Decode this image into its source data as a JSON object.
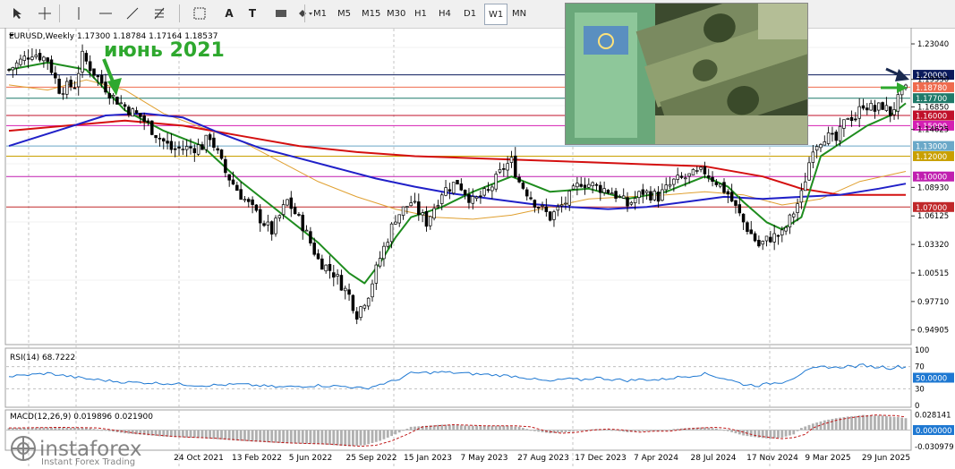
{
  "toolbar": {
    "tools": [
      {
        "name": "cursor-tool-icon"
      },
      {
        "name": "crosshair-tool-icon"
      },
      {
        "name": "vertical-line-tool-icon"
      },
      {
        "name": "horizontal-line-tool-icon"
      },
      {
        "name": "trendline-tool-icon"
      },
      {
        "name": "fibonacci-tool-icon"
      },
      {
        "name": "channel-tool-icon"
      },
      {
        "name": "text-tool-icon",
        "glyph": "A"
      },
      {
        "name": "text-label-tool-icon",
        "glyph": "T"
      },
      {
        "name": "rectangle-tool-icon"
      },
      {
        "name": "shapes-tool-icon"
      }
    ],
    "timeframes": [
      "M1",
      "M5",
      "M15",
      "M30",
      "H1",
      "H4",
      "D1",
      "W1",
      "MN"
    ],
    "active_timeframe": "W1"
  },
  "chart_data": {
    "type": "candlestick",
    "symbol_line": "EURUSD,Weekly  1.17300 1.18784 1.17164 1.18537",
    "annotation": "июнь 2021",
    "watermark": {
      "brand": "instaforex",
      "tagline": "Instant Forex Trading"
    },
    "price_axis": {
      "ylim": [
        0.9365,
        1.2445
      ],
      "ticks": [
        "1.23040",
        "1.20000",
        "1.19550",
        "1.18780",
        "1.17700",
        "1.16850",
        "1.16000",
        "1.15000",
        "1.14625",
        "1.13000",
        "1.12000",
        "1.10000",
        "1.08930",
        "1.07000",
        "1.06125",
        "1.03320",
        "1.00515",
        "0.97710",
        "0.94905"
      ]
    },
    "highlighted_levels": [
      {
        "label": "1.20000",
        "color": "#0a1a5c"
      },
      {
        "label": "1.18780",
        "color": "#ef6b4e"
      },
      {
        "label": "1.17700",
        "color": "#1f7a6a"
      },
      {
        "label": "1.16000",
        "color": "#c0102a"
      },
      {
        "label": "1.15000",
        "color": "#d41fb3"
      },
      {
        "label": "1.13000",
        "color": "#6aa8c8"
      },
      {
        "label": "1.12000",
        "color": "#c9a000"
      },
      {
        "label": "1.10000",
        "color": "#c01fb0"
      },
      {
        "label": "1.07000",
        "color": "#c0282a"
      }
    ],
    "x_labels": [
      "24 Oct 2021",
      "13 Feb 2022",
      "5 Jun 2022",
      "25 Sep 2022",
      "15 Jan 2023",
      "7 May 2023",
      "27 Aug 2023",
      "17 Dec 2023",
      "7 Apr 2024",
      "28 Jul 2024",
      "17 Nov 2024",
      "9 Mar 2025",
      "29 Jun 2025"
    ],
    "close_path": [
      [
        0,
        1.205
      ],
      [
        6,
        1.222
      ],
      [
        10,
        1.215
      ],
      [
        13,
        1.186
      ],
      [
        17,
        1.19
      ],
      [
        19,
        1.218
      ],
      [
        23,
        1.197
      ],
      [
        27,
        1.178
      ],
      [
        32,
        1.163
      ],
      [
        34,
        1.159
      ],
      [
        38,
        1.142
      ],
      [
        42,
        1.127
      ],
      [
        47,
        1.128
      ],
      [
        50,
        1.13
      ],
      [
        52,
        1.14
      ],
      [
        56,
        1.104
      ],
      [
        60,
        1.082
      ],
      [
        64,
        1.063
      ],
      [
        68,
        1.046
      ],
      [
        72,
        1.076
      ],
      [
        76,
        1.052
      ],
      [
        80,
        1.018
      ],
      [
        84,
        1.005
      ],
      [
        88,
        0.983
      ],
      [
        90,
        0.965
      ],
      [
        93,
        0.985
      ],
      [
        96,
        1.02
      ],
      [
        100,
        1.06
      ],
      [
        104,
        1.075
      ],
      [
        108,
        1.055
      ],
      [
        112,
        1.085
      ],
      [
        116,
        1.095
      ],
      [
        120,
        1.075
      ],
      [
        124,
        1.085
      ],
      [
        128,
        1.109
      ],
      [
        130,
        1.115
      ],
      [
        132,
        1.095
      ],
      [
        136,
        1.075
      ],
      [
        140,
        1.06
      ],
      [
        144,
        1.075
      ],
      [
        148,
        1.095
      ],
      [
        152,
        1.09
      ],
      [
        156,
        1.085
      ],
      [
        160,
        1.072
      ],
      [
        164,
        1.085
      ],
      [
        168,
        1.08
      ],
      [
        172,
        1.095
      ],
      [
        176,
        1.1
      ],
      [
        180,
        1.105
      ],
      [
        183,
        1.095
      ],
      [
        186,
        1.083
      ],
      [
        190,
        1.055
      ],
      [
        194,
        1.032
      ],
      [
        197,
        1.04
      ],
      [
        200,
        1.043
      ],
      [
        203,
        1.065
      ],
      [
        205,
        1.082
      ],
      [
        208,
        1.13
      ],
      [
        211,
        1.14
      ],
      [
        214,
        1.135
      ],
      [
        217,
        1.16
      ],
      [
        219,
        1.158
      ],
      [
        221,
        1.172
      ],
      [
        224,
        1.165
      ],
      [
        226,
        1.17
      ],
      [
        228,
        1.162
      ],
      [
        230,
        1.175
      ],
      [
        232,
        1.185
      ]
    ],
    "ma_fast": [
      [
        0,
        1.205
      ],
      [
        10,
        1.212
      ],
      [
        20,
        1.205
      ],
      [
        30,
        1.165
      ],
      [
        40,
        1.145
      ],
      [
        50,
        1.13
      ],
      [
        60,
        1.095
      ],
      [
        70,
        1.065
      ],
      [
        80,
        1.035
      ],
      [
        88,
        1.005
      ],
      [
        92,
        0.995
      ],
      [
        96,
        1.015
      ],
      [
        100,
        1.04
      ],
      [
        104,
        1.06
      ],
      [
        112,
        1.07
      ],
      [
        120,
        1.085
      ],
      [
        130,
        1.1
      ],
      [
        140,
        1.085
      ],
      [
        150,
        1.088
      ],
      [
        160,
        1.078
      ],
      [
        170,
        1.085
      ],
      [
        180,
        1.1
      ],
      [
        186,
        1.09
      ],
      [
        190,
        1.075
      ],
      [
        196,
        1.055
      ],
      [
        200,
        1.048
      ],
      [
        205,
        1.06
      ],
      [
        210,
        1.12
      ],
      [
        216,
        1.135
      ],
      [
        222,
        1.15
      ],
      [
        228,
        1.16
      ],
      [
        232,
        1.172
      ]
    ],
    "ma_slow_orange": [
      [
        0,
        1.19
      ],
      [
        10,
        1.185
      ],
      [
        20,
        1.195
      ],
      [
        30,
        1.185
      ],
      [
        40,
        1.162
      ],
      [
        50,
        1.148
      ],
      [
        60,
        1.135
      ],
      [
        70,
        1.115
      ],
      [
        80,
        1.095
      ],
      [
        90,
        1.08
      ],
      [
        100,
        1.068
      ],
      [
        110,
        1.06
      ],
      [
        120,
        1.058
      ],
      [
        130,
        1.062
      ],
      [
        140,
        1.07
      ],
      [
        150,
        1.078
      ],
      [
        160,
        1.08
      ],
      [
        170,
        1.082
      ],
      [
        180,
        1.085
      ],
      [
        190,
        1.082
      ],
      [
        200,
        1.072
      ],
      [
        210,
        1.078
      ],
      [
        220,
        1.095
      ],
      [
        232,
        1.105
      ]
    ],
    "ma_blue": [
      [
        0,
        1.13
      ],
      [
        15,
        1.148
      ],
      [
        25,
        1.16
      ],
      [
        35,
        1.162
      ],
      [
        45,
        1.158
      ],
      [
        55,
        1.142
      ],
      [
        65,
        1.128
      ],
      [
        75,
        1.118
      ],
      [
        85,
        1.108
      ],
      [
        95,
        1.098
      ],
      [
        105,
        1.09
      ],
      [
        115,
        1.083
      ],
      [
        125,
        1.078
      ],
      [
        135,
        1.073
      ],
      [
        145,
        1.07
      ],
      [
        155,
        1.068
      ],
      [
        165,
        1.07
      ],
      [
        175,
        1.075
      ],
      [
        185,
        1.08
      ],
      [
        195,
        1.078
      ],
      [
        205,
        1.08
      ],
      [
        215,
        1.082
      ],
      [
        225,
        1.088
      ],
      [
        232,
        1.093
      ]
    ],
    "ma_red": [
      [
        0,
        1.145
      ],
      [
        15,
        1.15
      ],
      [
        30,
        1.155
      ],
      [
        45,
        1.15
      ],
      [
        60,
        1.14
      ],
      [
        75,
        1.13
      ],
      [
        90,
        1.124
      ],
      [
        105,
        1.12
      ],
      [
        120,
        1.118
      ],
      [
        135,
        1.116
      ],
      [
        150,
        1.114
      ],
      [
        165,
        1.112
      ],
      [
        180,
        1.11
      ],
      [
        195,
        1.1
      ],
      [
        205,
        1.088
      ],
      [
        215,
        1.082
      ],
      [
        232,
        1.082
      ]
    ],
    "rsi": {
      "label": "RSI(14) 68.7222",
      "ylim": [
        0,
        100
      ],
      "ticks": [
        "100",
        "70",
        "50.0000",
        "30",
        "0"
      ],
      "marker_value": 50,
      "values": [
        [
          0,
          52
        ],
        [
          10,
          58
        ],
        [
          20,
          48
        ],
        [
          30,
          42
        ],
        [
          40,
          40
        ],
        [
          50,
          36
        ],
        [
          60,
          38
        ],
        [
          70,
          33
        ],
        [
          80,
          36
        ],
        [
          88,
          34
        ],
        [
          92,
          30
        ],
        [
          96,
          38
        ],
        [
          100,
          45
        ],
        [
          104,
          58
        ],
        [
          112,
          60
        ],
        [
          120,
          57
        ],
        [
          128,
          54
        ],
        [
          132,
          52
        ],
        [
          136,
          47
        ],
        [
          140,
          43
        ],
        [
          144,
          48
        ],
        [
          148,
          46
        ],
        [
          152,
          50
        ],
        [
          156,
          47
        ],
        [
          160,
          45
        ],
        [
          164,
          47
        ],
        [
          168,
          46
        ],
        [
          172,
          50
        ],
        [
          176,
          53
        ],
        [
          180,
          57
        ],
        [
          183,
          52
        ],
        [
          186,
          47
        ],
        [
          190,
          38
        ],
        [
          194,
          36
        ],
        [
          197,
          40
        ],
        [
          200,
          42
        ],
        [
          203,
          50
        ],
        [
          205,
          58
        ],
        [
          208,
          66
        ],
        [
          211,
          70
        ],
        [
          214,
          68
        ],
        [
          217,
          71
        ],
        [
          219,
          70
        ],
        [
          221,
          73
        ],
        [
          224,
          69
        ],
        [
          226,
          70
        ],
        [
          228,
          67
        ],
        [
          230,
          70
        ],
        [
          232,
          69
        ]
      ]
    },
    "macd": {
      "label": "MACD(12,26,9) 0.019896 0.021900",
      "ylim": [
        -0.034,
        0.034
      ],
      "ticks": [
        "0.028141",
        "0.000000",
        "-0.030979"
      ],
      "values": [
        [
          0,
          0.004
        ],
        [
          10,
          0.005
        ],
        [
          20,
          0.004
        ],
        [
          30,
          -0.006
        ],
        [
          40,
          -0.012
        ],
        [
          50,
          -0.015
        ],
        [
          60,
          -0.02
        ],
        [
          70,
          -0.024
        ],
        [
          80,
          -0.026
        ],
        [
          88,
          -0.03
        ],
        [
          92,
          -0.028
        ],
        [
          96,
          -0.02
        ],
        [
          100,
          -0.008
        ],
        [
          104,
          0.006
        ],
        [
          112,
          0.01
        ],
        [
          120,
          0.008
        ],
        [
          128,
          0.008
        ],
        [
          132,
          0.006
        ],
        [
          136,
          -0.002
        ],
        [
          140,
          -0.006
        ],
        [
          144,
          -0.004
        ],
        [
          148,
          0.0
        ],
        [
          152,
          0.002
        ],
        [
          156,
          0.0
        ],
        [
          160,
          -0.004
        ],
        [
          164,
          -0.002
        ],
        [
          168,
          -0.002
        ],
        [
          172,
          0.002
        ],
        [
          176,
          0.004
        ],
        [
          180,
          0.005
        ],
        [
          183,
          0.003
        ],
        [
          186,
          -0.002
        ],
        [
          190,
          -0.01
        ],
        [
          194,
          -0.014
        ],
        [
          197,
          -0.016
        ],
        [
          200,
          -0.014
        ],
        [
          203,
          -0.008
        ],
        [
          205,
          0.004
        ],
        [
          208,
          0.012
        ],
        [
          211,
          0.018
        ],
        [
          214,
          0.022
        ],
        [
          217,
          0.025
        ],
        [
          219,
          0.026
        ],
        [
          221,
          0.028
        ],
        [
          224,
          0.027
        ],
        [
          226,
          0.027
        ],
        [
          228,
          0.025
        ],
        [
          230,
          0.024
        ],
        [
          232,
          0.022
        ]
      ]
    }
  }
}
